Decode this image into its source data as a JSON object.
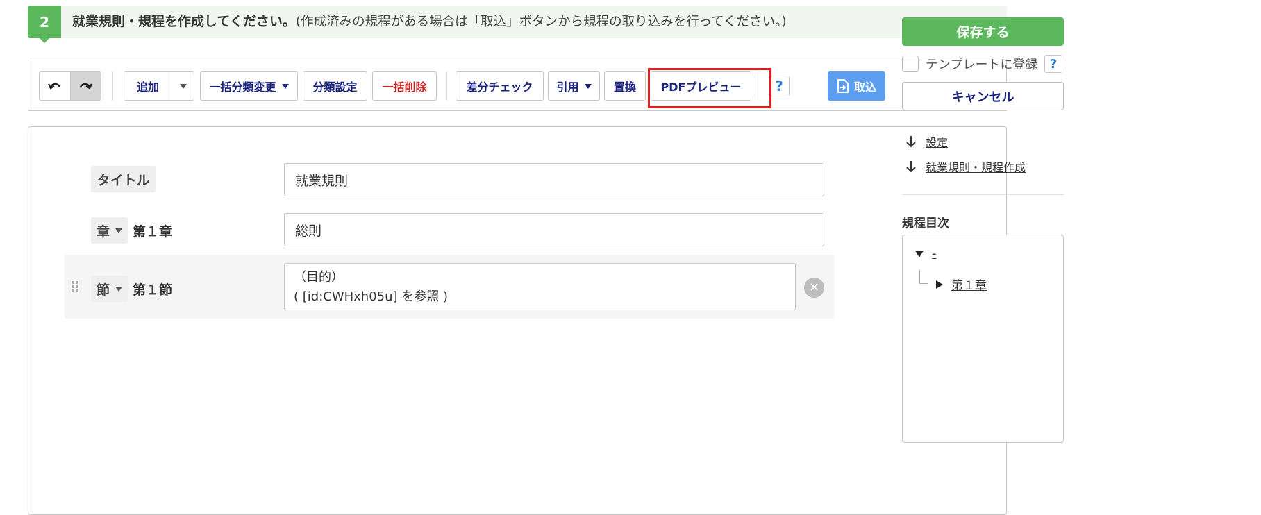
{
  "step": {
    "number": "2",
    "title": "就業規則・規程を作成してください。",
    "note": "(作成済みの規程がある場合は「取込」ボタンから規程の取り込みを行ってください。)"
  },
  "toolbar": {
    "add": "追加",
    "bulk_category": "一括分類変更",
    "category_settings": "分類設定",
    "bulk_delete": "一括削除",
    "diff_check": "差分チェック",
    "quote": "引用",
    "replace": "置換",
    "pdf_preview": "PDFプレビュー",
    "help": "?",
    "import": "取込"
  },
  "editor": {
    "title_tag": "タイトル",
    "title_value": "就業規則",
    "chapter_tag": "章",
    "chapter_num": "第１章",
    "chapter_value": "総則",
    "section_tag": "節",
    "section_num": "第１節",
    "section_line1": "（目的）",
    "section_line2": "( [id:CWHxh05u] を参照 )"
  },
  "side": {
    "save": "保存する",
    "template_label": "テンプレートに登録",
    "template_help": "?",
    "cancel": "キャンセル",
    "anchor_settings": "設定",
    "anchor_create": "就業規則・規程作成",
    "toc_title": "規程目次",
    "toc_root": "-",
    "toc_chapter": "第１章"
  },
  "colors": {
    "accent_green": "#5cb85c",
    "import_blue": "#5b9ef0",
    "highlight_red": "#e02020",
    "delete_red": "#c62828",
    "navy": "#1a237e"
  }
}
